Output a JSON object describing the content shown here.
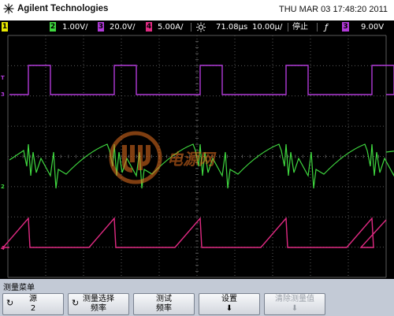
{
  "header": {
    "brand": "Agilent Technologies",
    "datetime": "THU MAR 03 17:48:20 2011"
  },
  "status_bar": {
    "ch1_num": "1",
    "ch2_num": "2",
    "ch2_scale": "1.00V/",
    "ch3_num": "3",
    "ch3_scale": "20.0V/",
    "ch4_num": "4",
    "ch4_scale": "5.00A/",
    "time_offset": "71.08µs",
    "time_scale": "10.00µ/",
    "run_state": "停止",
    "trigger_symbol": "ƒ",
    "trigger_source": "3",
    "trigger_level": "9.00V"
  },
  "traces": {
    "ch3_label": "3",
    "ch2_label": "2",
    "ch4_label": "4",
    "trigger_marker": "T",
    "colors": {
      "ch1": "#e8e800",
      "ch2": "#3fd83f",
      "ch3": "#b13ad8",
      "ch4": "#e02a82",
      "background": "#000000",
      "grid": "#5a5a5a"
    }
  },
  "watermark": {
    "text": "电源网"
  },
  "menu": {
    "title": "测量菜单",
    "softkeys": [
      {
        "line1": "源",
        "line2": "2",
        "knob": "↻",
        "enabled": true
      },
      {
        "line1": "测量选择",
        "line2": "频率",
        "knob": "↻",
        "enabled": true
      },
      {
        "line1": "测试",
        "line2": "频率",
        "knob": "",
        "enabled": true
      },
      {
        "line1": "设置",
        "line2": "⬇",
        "knob": "",
        "enabled": true
      },
      {
        "line1": "清除测量值",
        "line2": "⬇",
        "knob": "",
        "enabled": false
      }
    ]
  }
}
